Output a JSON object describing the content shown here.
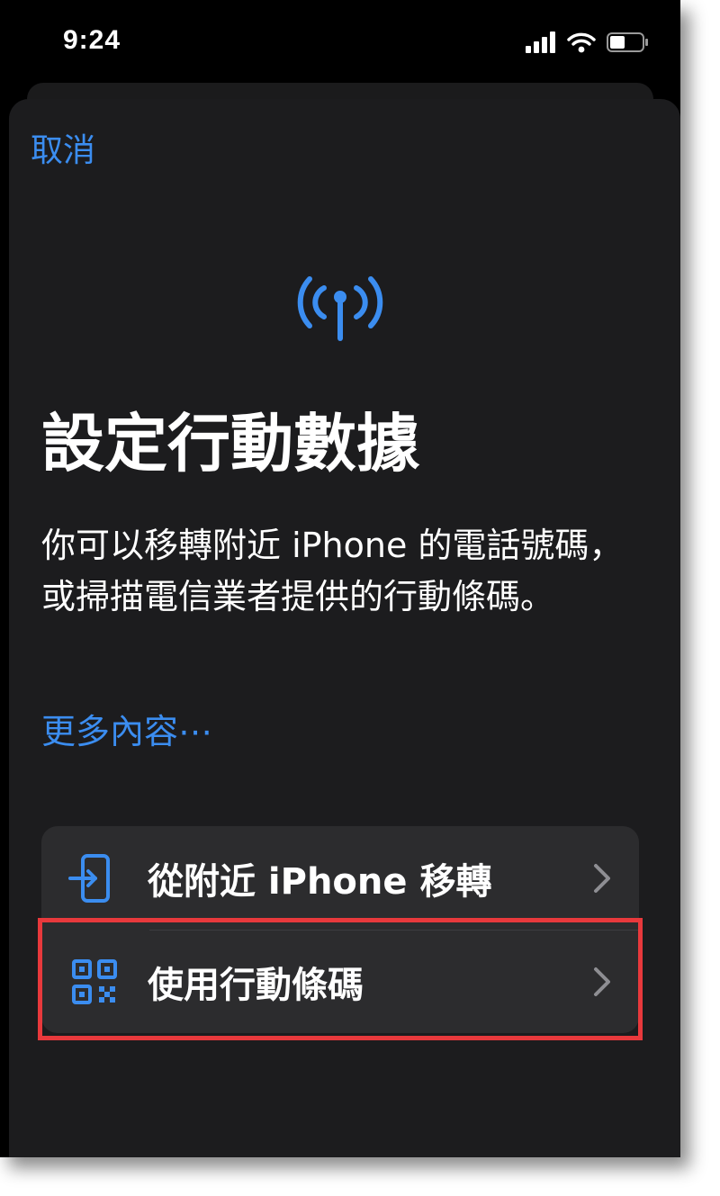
{
  "status_bar": {
    "time": "9:24"
  },
  "header": {
    "cancel_label": "取消"
  },
  "main": {
    "icon": "antenna-signal-icon",
    "title": "設定行動數據",
    "description": "你可以移轉附近 iPhone 的電話號碼，或掃描電信業者提供的行動條碼。",
    "more_link": "更多內容⋯"
  },
  "options": [
    {
      "label": "從附近 iPhone 移轉",
      "icon": "phone-transfer-icon"
    },
    {
      "label": "使用行動條碼",
      "icon": "qr-code-icon"
    }
  ],
  "colors": {
    "accent": "#3b8df0",
    "background": "#000000",
    "sheet": "#1c1c1e",
    "row": "#2c2c2e",
    "highlight": "#e8393c"
  }
}
